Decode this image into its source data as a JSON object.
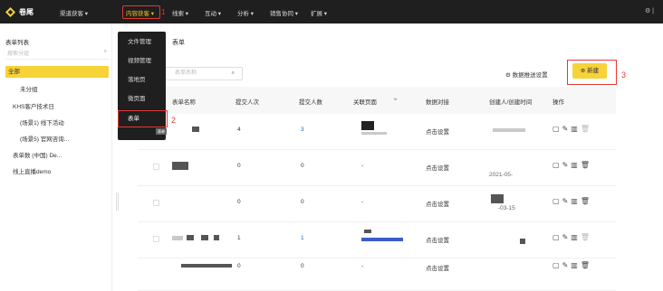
{
  "topbar": {
    "logo_text": "卷尾",
    "nav": [
      {
        "label": "渠道获客 ▾"
      },
      {
        "label": "内容获客 ▾"
      },
      {
        "label": "线索 ▾"
      },
      {
        "label": "互动 ▾"
      },
      {
        "label": "分析 ▾"
      },
      {
        "label": "销售协同 ▾"
      },
      {
        "label": "扩展 ▾"
      }
    ],
    "right_text": "⚙ |"
  },
  "dropdown": {
    "items": [
      "文件管理",
      "视频管理",
      "落地页",
      "微页面",
      "表单"
    ],
    "tooltip": "表单"
  },
  "annotations": [
    "1",
    "2",
    "3"
  ],
  "sidebar": {
    "title": "表单列表",
    "search_placeholder": "搜索分组",
    "items": [
      "全部",
      "未分组",
      "KHS客户技术日",
      "(场景1) 线下活动",
      "(场景5) 官网咨询...",
      "表单数 (中国) De...",
      "线上直播demo"
    ]
  },
  "main": {
    "title": "表单",
    "search_placeholder": "表单名称",
    "push_setting": "数据推送设置",
    "new_button": "新建"
  },
  "table": {
    "headers": [
      "表单名称",
      "提交人次",
      "提交人数",
      "关联页面",
      "数据对接",
      "创建人/创建时间",
      "操作"
    ],
    "rows": [
      {
        "submits": "4",
        "people": "3",
        "page": "",
        "sync": "点击设置",
        "created": ""
      },
      {
        "submits": "0",
        "people": "0",
        "page": "-",
        "sync": "点击设置",
        "created": "2021-05-"
      },
      {
        "submits": "0",
        "people": "0",
        "page": "-",
        "sync": "点击设置",
        "created": "-03-15"
      },
      {
        "submits": "1",
        "people": "1",
        "page": "",
        "sync": "点击设置",
        "created": ""
      },
      {
        "submits": "0",
        "people": "0",
        "page": "-",
        "sync": "点击设置",
        "created": ""
      }
    ]
  },
  "colors": {
    "accent": "#f7d238",
    "topbar": "#1f1f1f",
    "highlight": "#e53935",
    "link": "#1e63d6"
  }
}
